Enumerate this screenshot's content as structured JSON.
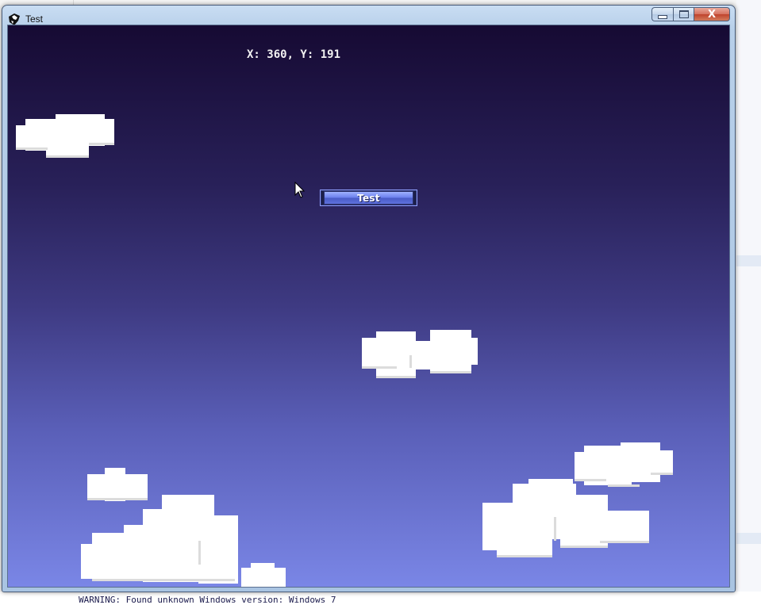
{
  "window": {
    "title": "Test",
    "app_icon": "game-app-icon",
    "controls": {
      "minimize_icon": "minimize-icon",
      "maximize_icon": "maximize-icon",
      "close_label": "X"
    }
  },
  "game": {
    "coordinates_text": "X: 360, Y: 191",
    "button_label": "Test",
    "cursor_icon": "arrow-cursor-icon",
    "sky_colors": {
      "top": "#160a33",
      "bottom": "#7a86e6"
    },
    "cloud_color": "#ffffff",
    "cloud_shade": "#dcdcdc"
  },
  "console": {
    "warning_text": "WARNING: Found unknown Windows version: Windows 7"
  }
}
